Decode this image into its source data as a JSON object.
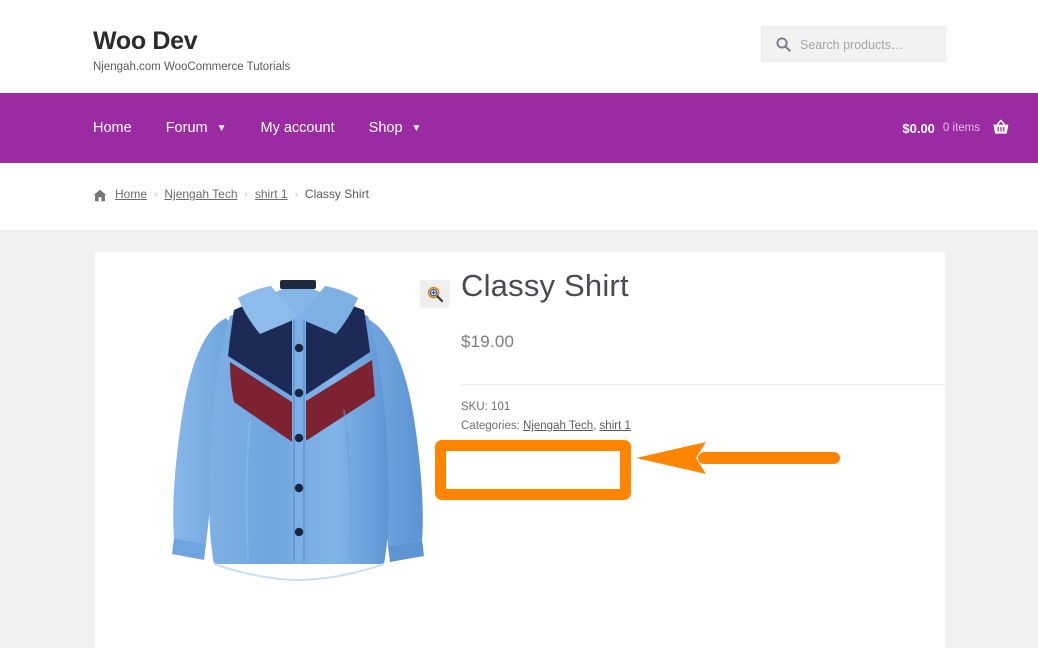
{
  "header": {
    "site_title": "Woo Dev",
    "tagline": "Njengah.com WooCommerce Tutorials",
    "search": {
      "placeholder": "Search products…",
      "value": "",
      "icon": "search-icon"
    }
  },
  "nav": {
    "background_color": "#9b2ba3",
    "items": [
      {
        "label": "Home",
        "has_dropdown": false
      },
      {
        "label": "Forum",
        "has_dropdown": true
      },
      {
        "label": "My account",
        "has_dropdown": false
      },
      {
        "label": "Shop",
        "has_dropdown": true
      }
    ],
    "cart": {
      "amount": "$0.00",
      "count": "0 items",
      "icon": "shopping-basket-icon"
    }
  },
  "breadcrumb": {
    "home_icon": "home-icon",
    "separator": "›",
    "items": [
      {
        "label": "Home",
        "link": true
      },
      {
        "label": "Njengah Tech",
        "link": true
      },
      {
        "label": "shirt 1",
        "link": true
      },
      {
        "label": "Classy Shirt",
        "link": false
      }
    ]
  },
  "product": {
    "title": "Classy Shirt",
    "price": "$19.00",
    "sku_label": "SKU:",
    "sku_value": "101",
    "categories_label": "Categories:",
    "categories": [
      "Njengah Tech",
      "shirt 1"
    ],
    "categories_separator": ", ",
    "gallery": {
      "image_alt": "Classy Shirt blue dress shirt with navy and maroon chevron panels",
      "zoom_icon": "magnifier-plus-icon"
    }
  },
  "annotation": {
    "color": "#ff8400",
    "box_label": "",
    "shapes": [
      "highlight-rectangle",
      "left-pointing-arrow"
    ]
  }
}
